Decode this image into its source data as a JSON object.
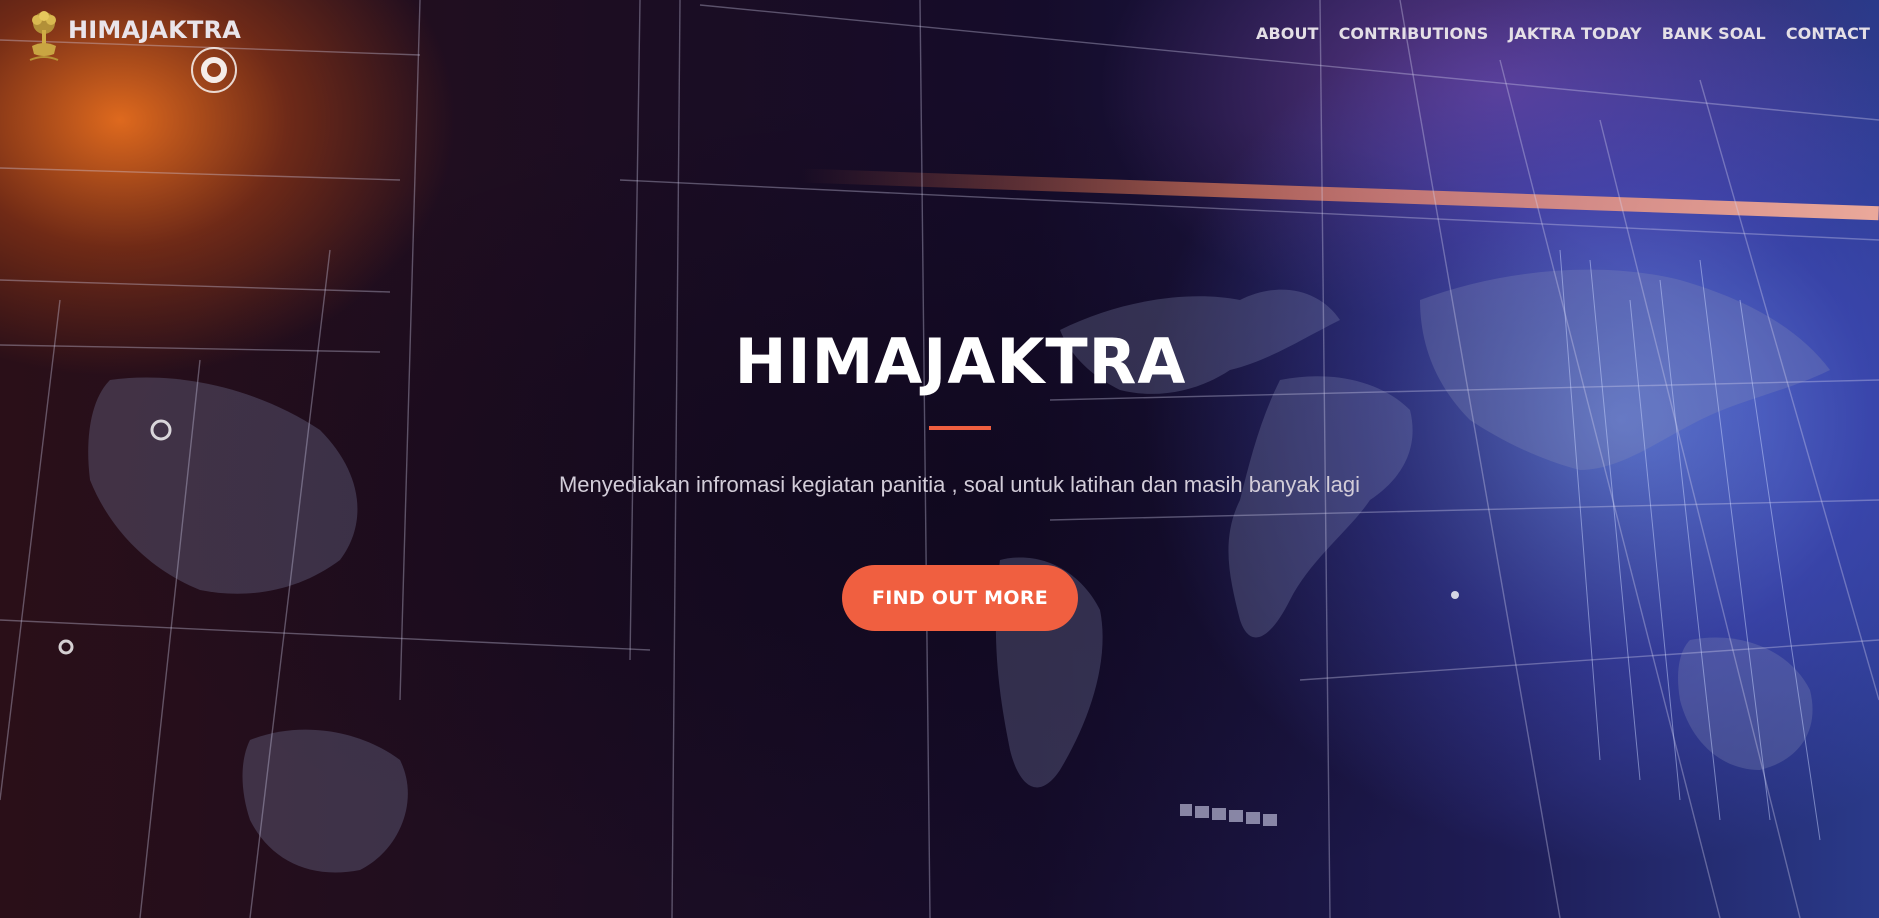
{
  "brand": {
    "name": "HIMAJAKTRA",
    "logo_icon": "tree-emblem-icon"
  },
  "nav": {
    "items": [
      {
        "label": "ABOUT"
      },
      {
        "label": "CONTRIBUTIONS"
      },
      {
        "label": "JAKTRA TODAY"
      },
      {
        "label": "BANK SOAL"
      },
      {
        "label": "CONTACT"
      }
    ]
  },
  "hero": {
    "title": "HIMAJAKTRA",
    "subtitle": "Menyediakan infromasi kegiatan panitia , soal untuk latihan dan masih banyak lagi",
    "cta_label": "FIND OUT MORE",
    "background_image": "world-map-tech-grid"
  },
  "colors": {
    "accent": "#f05f40",
    "text_light": "#ffffff",
    "nav_text": "#e4dfe6",
    "subtitle_text": "#d2ccd8"
  }
}
